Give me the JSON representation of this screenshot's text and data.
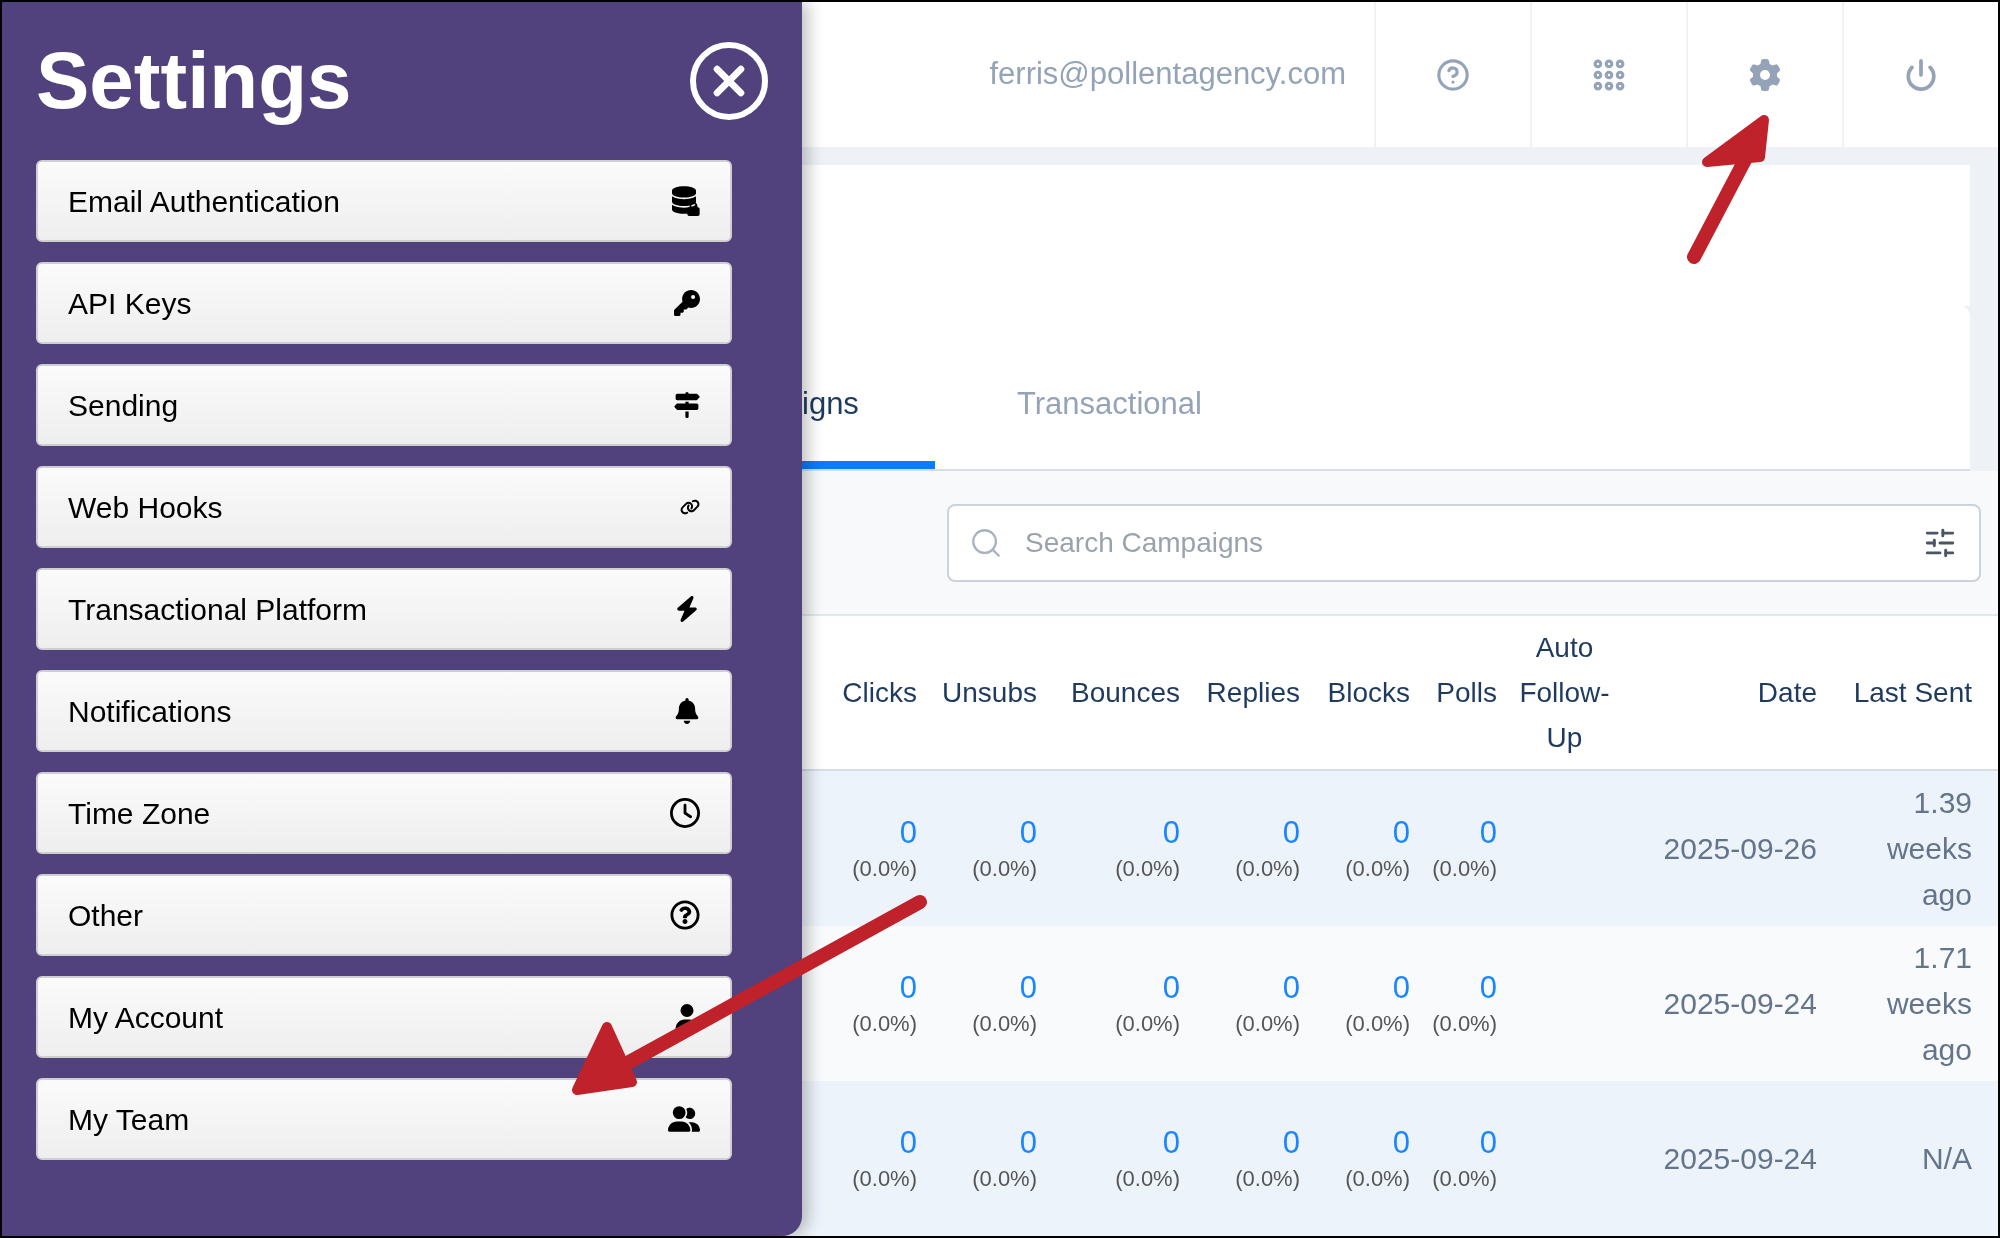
{
  "settings_panel": {
    "title": "Settings",
    "items": [
      {
        "label": "Email Authentication"
      },
      {
        "label": "API Keys"
      },
      {
        "label": "Sending"
      },
      {
        "label": "Web Hooks"
      },
      {
        "label": "Transactional Platform"
      },
      {
        "label": "Notifications"
      },
      {
        "label": "Time Zone"
      },
      {
        "label": "Other"
      },
      {
        "label": "My Account"
      },
      {
        "label": "My Team"
      }
    ]
  },
  "header": {
    "email": "ferris@pollentagency.com"
  },
  "tabs": [
    {
      "label": "igns",
      "selected": true
    },
    {
      "label": "Transactional",
      "selected": false
    }
  ],
  "search": {
    "placeholder": "Search Campaigns"
  },
  "table": {
    "columns": [
      "Clicks",
      "Unsubs",
      "Bounces",
      "Replies",
      "Blocks",
      "Polls",
      "Auto Follow-Up",
      "Date",
      "Last Sent"
    ],
    "rows": [
      {
        "stats": [
          {
            "count": "0",
            "percent": "(0.0%)"
          },
          {
            "count": "0",
            "percent": "(0.0%)"
          },
          {
            "count": "0",
            "percent": "(0.0%)"
          },
          {
            "count": "0",
            "percent": "(0.0%)"
          },
          {
            "count": "0",
            "percent": "(0.0%)"
          },
          {
            "count": "0",
            "percent": "(0.0%)"
          }
        ],
        "date": "2025-09-26",
        "last_sent": "1.39 weeks ago"
      },
      {
        "stats": [
          {
            "count": "0",
            "percent": "(0.0%)"
          },
          {
            "count": "0",
            "percent": "(0.0%)"
          },
          {
            "count": "0",
            "percent": "(0.0%)"
          },
          {
            "count": "0",
            "percent": "(0.0%)"
          },
          {
            "count": "0",
            "percent": "(0.0%)"
          },
          {
            "count": "0",
            "percent": "(0.0%)"
          }
        ],
        "date": "2025-09-24",
        "last_sent": "1.71 weeks ago"
      },
      {
        "stats": [
          {
            "count": "0",
            "percent": "(0.0%)"
          },
          {
            "count": "0",
            "percent": "(0.0%)"
          },
          {
            "count": "0",
            "percent": "(0.0%)"
          },
          {
            "count": "0",
            "percent": "(0.0%)"
          },
          {
            "count": "0",
            "percent": "(0.0%)"
          },
          {
            "count": "0",
            "percent": "(0.0%)"
          }
        ],
        "date": "2025-09-24",
        "last_sent": "N/A"
      }
    ]
  }
}
